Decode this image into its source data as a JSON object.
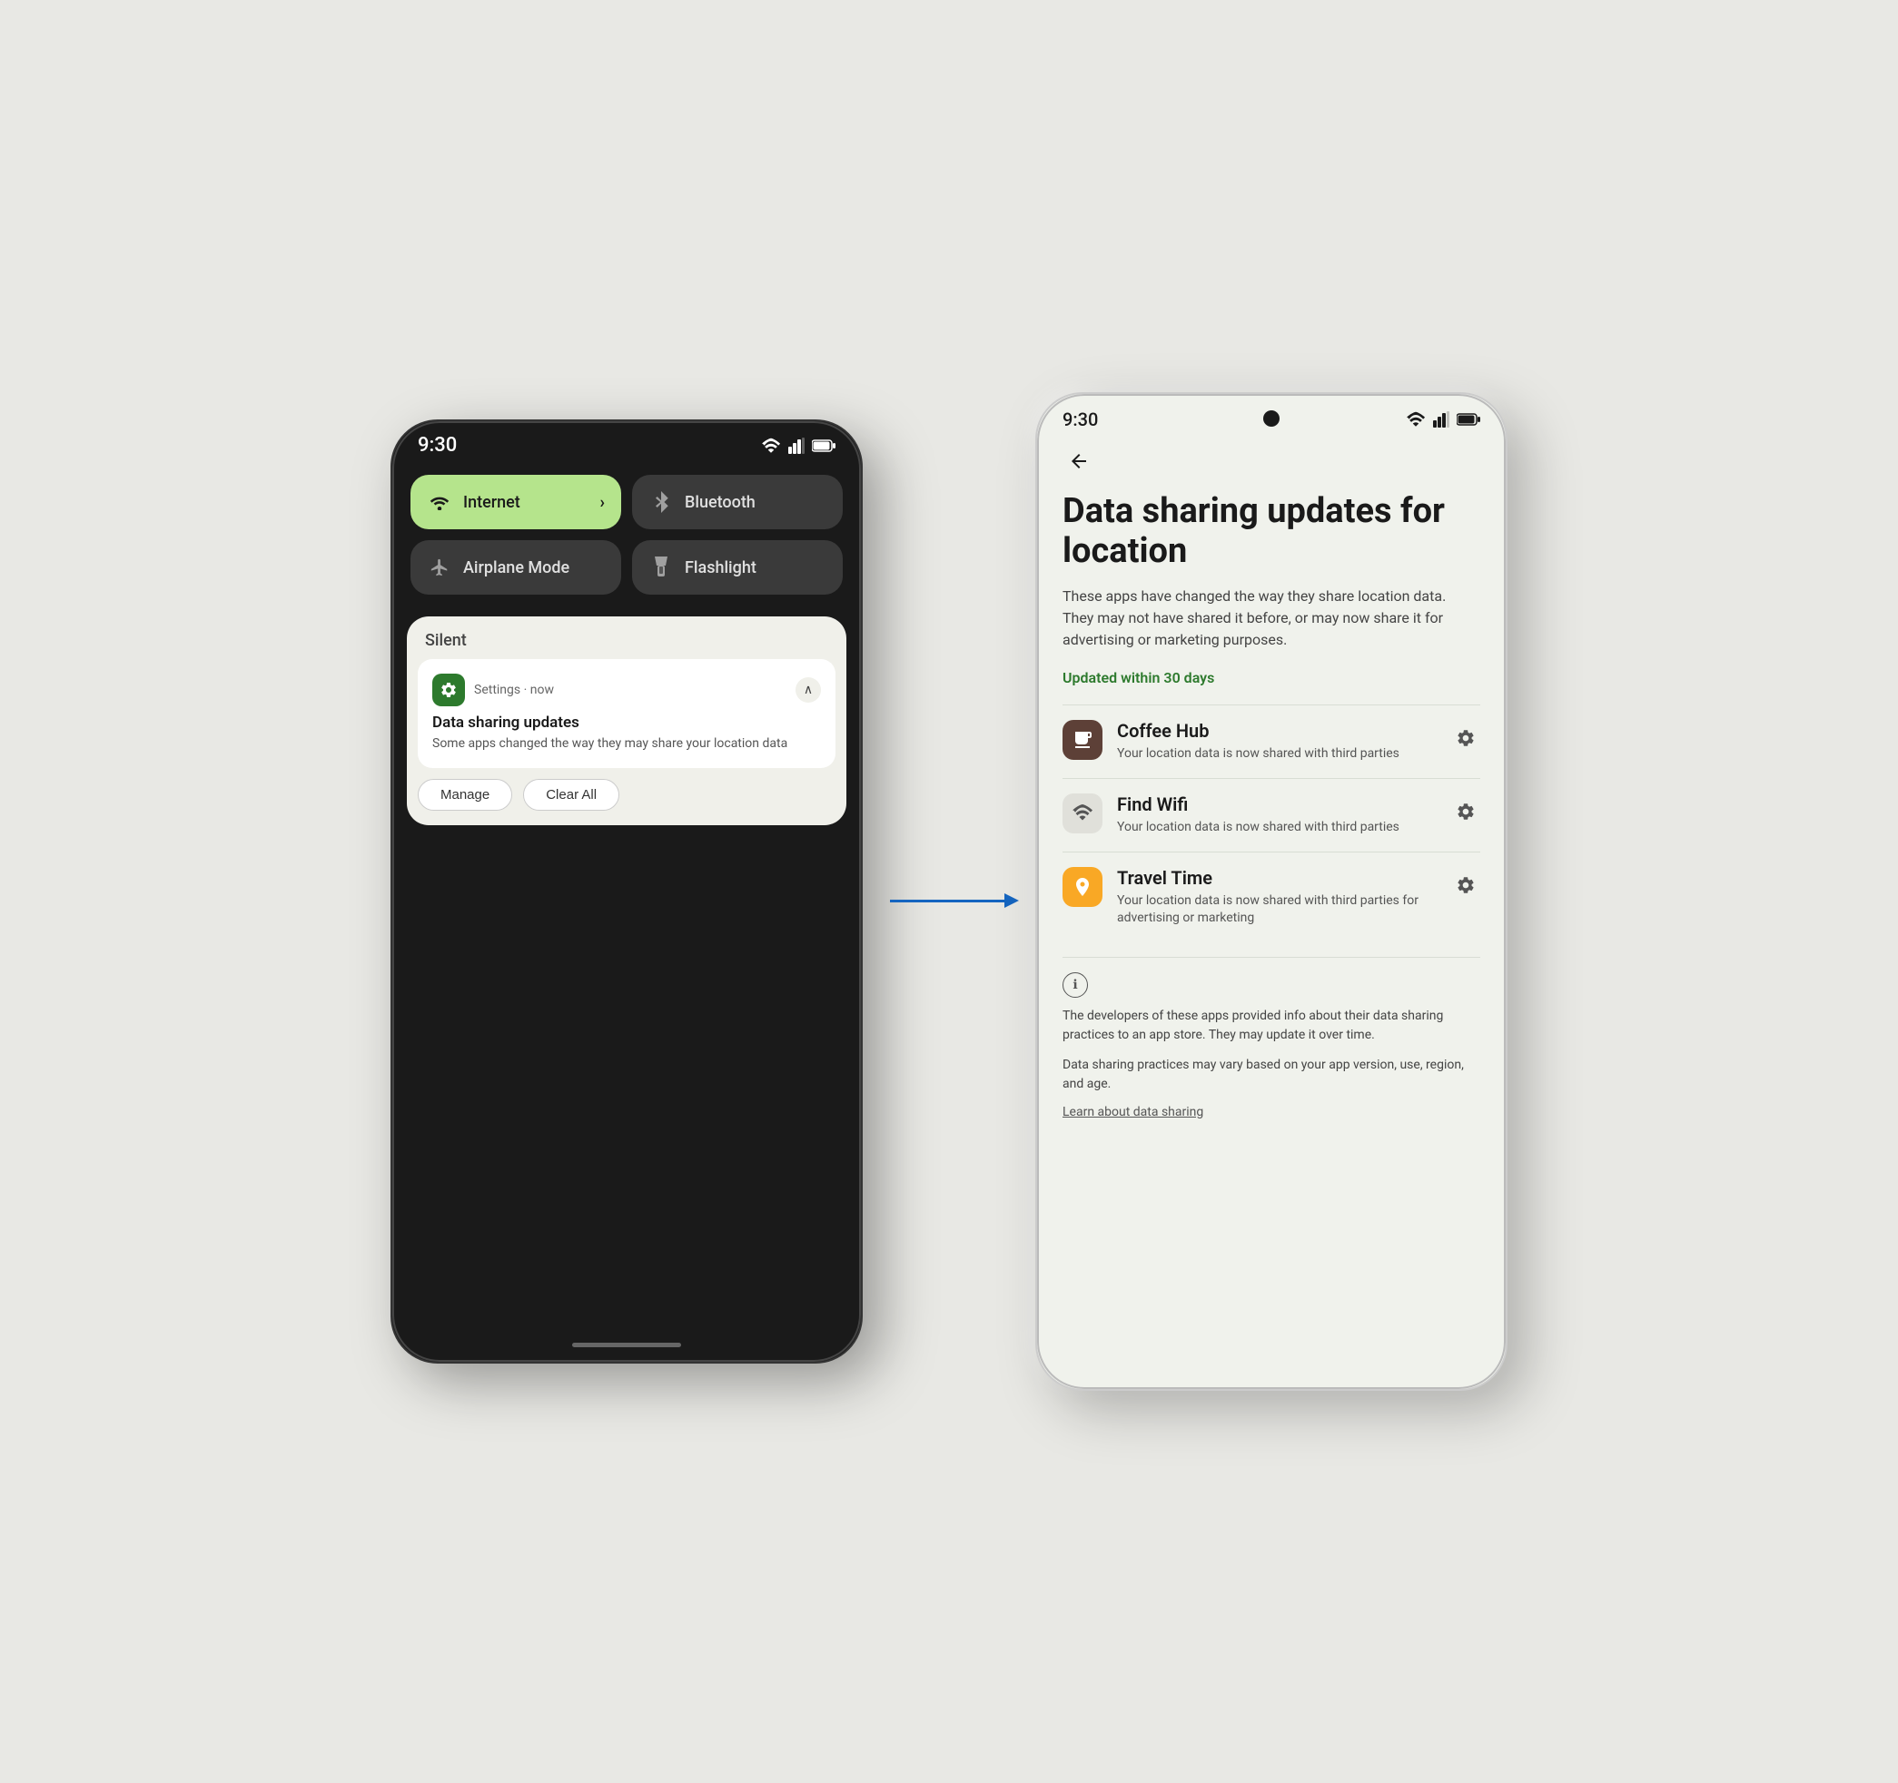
{
  "phone_left": {
    "status_time": "9:30",
    "tiles": [
      {
        "id": "internet",
        "label": "Internet",
        "active": true,
        "has_arrow": true
      },
      {
        "id": "bluetooth",
        "label": "Bluetooth",
        "active": false
      },
      {
        "id": "airplane",
        "label": "Airplane Mode",
        "active": false
      },
      {
        "id": "flashlight",
        "label": "Flashlight",
        "active": false
      }
    ],
    "silent_label": "Silent",
    "notification": {
      "source": "Settings · now",
      "title": "Data sharing updates",
      "body": "Some apps changed the way they may share your location data",
      "btn_manage": "Manage",
      "btn_clear": "Clear All"
    }
  },
  "phone_right": {
    "status_time": "9:30",
    "page_title": "Data sharing updates for location",
    "page_subtitle": "These apps have changed the way they share location data. They may not have shared it before, or may now share it for advertising or marketing purposes.",
    "updated_label": "Updated within 30 days",
    "apps": [
      {
        "id": "coffee-hub",
        "name": "Coffee Hub",
        "desc": "Your location data is now shared with third parties",
        "icon_type": "coffee"
      },
      {
        "id": "find-wifi",
        "name": "Find Wifi",
        "desc": "Your location data is now shared with third parties",
        "icon_type": "wifi"
      },
      {
        "id": "travel-time",
        "name": "Travel Time",
        "desc": "Your location data is now shared with third parties for advertising or marketing",
        "icon_type": "travel"
      }
    ],
    "info_text_1": "The developers of these apps provided info about their data sharing practices to an app store. They may update it over time.",
    "info_text_2": "Data sharing practices may vary based on your app version, use, region, and age.",
    "learn_link": "Learn about data sharing"
  }
}
